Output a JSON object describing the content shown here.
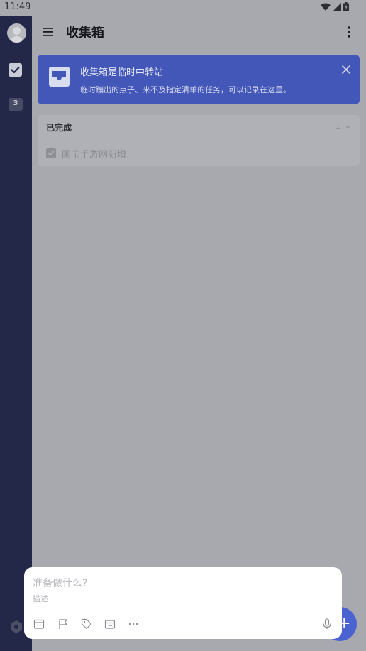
{
  "status_bar": {
    "time": "11:49"
  },
  "sidebar": {
    "calendar_day": "3"
  },
  "header": {
    "title": "收集箱"
  },
  "banner": {
    "title": "收集箱是临时中转站",
    "text": "临时蹦出的点子、来不及指定清单的任务，可以记录在这里。"
  },
  "completed": {
    "label": "已完成",
    "count": "1",
    "tasks": [
      {
        "title": "国宝手游网新增"
      }
    ]
  },
  "composer": {
    "title_placeholder": "准备做什么?",
    "description_placeholder": "描述"
  },
  "colors": {
    "rail": "#232849",
    "banner": "#4357b8",
    "fab": "#4a63d0"
  }
}
